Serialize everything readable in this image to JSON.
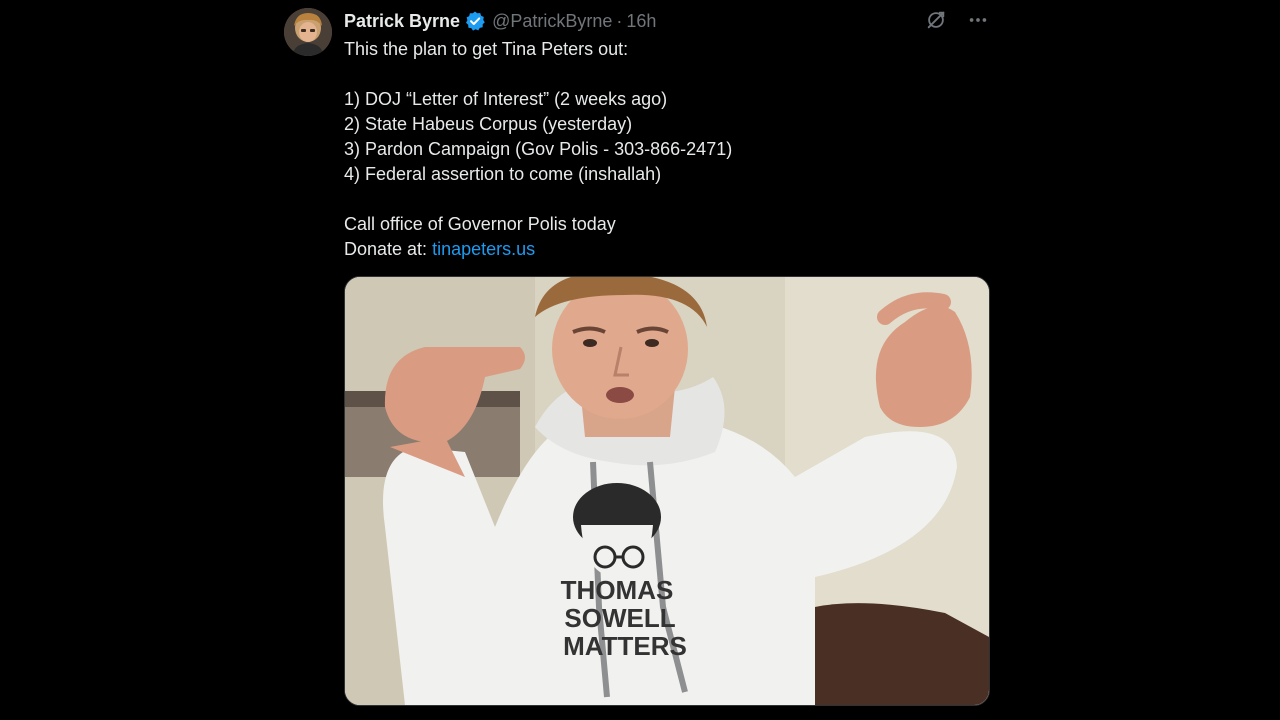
{
  "tweet": {
    "display_name": "Patrick Byrne",
    "handle": "@PatrickByrne",
    "separator": "·",
    "time": "16h",
    "lines": {
      "intro": "This the plan to get Tina Peters out:",
      "item1": "1) DOJ “Letter of Interest” (2 weeks ago)",
      "item2": "2) State Habeus Corpus (yesterday)",
      "item3": "3) Pardon Campaign (Gov Polis - 303-866-2471)",
      "item4": "4) Federal assertion to come (inshallah)",
      "call": "Call office of Governor Polis today",
      "donate_prefix": "Donate at: ",
      "donate_link": "tinapeters.us"
    },
    "media": {
      "shirt_text": {
        "line1": "THOMAS",
        "line2": "SOWELL",
        "line3": "MATTERS"
      }
    }
  },
  "icons": {
    "verified": "verified-badge-icon",
    "grok": "grok-icon",
    "more": "more-icon"
  },
  "colors": {
    "background": "#000000",
    "text": "#e7e9ea",
    "muted": "#71767b",
    "link": "#1d9bf0",
    "verified": "#1d9bf0"
  }
}
